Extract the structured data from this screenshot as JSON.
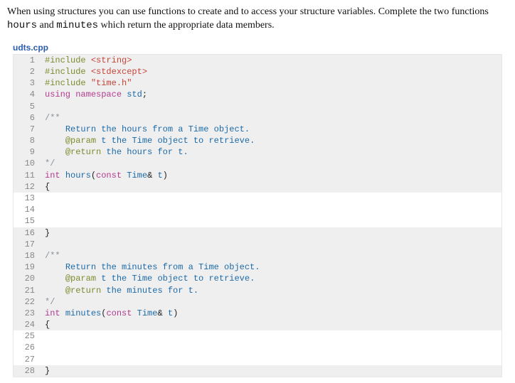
{
  "intro": {
    "part1": "When using structures you can use functions to create and to access your structure variables. Complete the two functions ",
    "func1": "hours",
    "and": " and ",
    "func2": "minutes",
    "part2": " which return the appropriate data members."
  },
  "filename": "udts.cpp",
  "lines": [
    {
      "n": "1",
      "bg": "gray",
      "segs": [
        {
          "cls": "tok-pp",
          "t": "#include "
        },
        {
          "cls": "tok-str",
          "t": "<string>"
        }
      ]
    },
    {
      "n": "2",
      "bg": "gray",
      "segs": [
        {
          "cls": "tok-pp",
          "t": "#include "
        },
        {
          "cls": "tok-str",
          "t": "<stdexcept>"
        }
      ]
    },
    {
      "n": "3",
      "bg": "gray",
      "segs": [
        {
          "cls": "tok-pp",
          "t": "#include "
        },
        {
          "cls": "tok-str",
          "t": "\"time.h\""
        }
      ]
    },
    {
      "n": "4",
      "bg": "gray",
      "segs": [
        {
          "cls": "tok-kw",
          "t": "using"
        },
        {
          "cls": "",
          "t": " "
        },
        {
          "cls": "tok-kw",
          "t": "namespace"
        },
        {
          "cls": "",
          "t": " "
        },
        {
          "cls": "tok-id",
          "t": "std"
        },
        {
          "cls": "",
          "t": ";"
        }
      ]
    },
    {
      "n": "5",
      "bg": "gray",
      "segs": [
        {
          "cls": "",
          "t": ""
        }
      ]
    },
    {
      "n": "6",
      "bg": "gray",
      "segs": [
        {
          "cls": "tok-comm",
          "t": "/**"
        }
      ]
    },
    {
      "n": "7",
      "bg": "gray",
      "segs": [
        {
          "cls": "",
          "t": "    "
        },
        {
          "cls": "tok-doc",
          "t": "Return the hours from a Time object."
        }
      ]
    },
    {
      "n": "8",
      "bg": "gray",
      "segs": [
        {
          "cls": "",
          "t": "    "
        },
        {
          "cls": "tok-pp",
          "t": "@param"
        },
        {
          "cls": "",
          "t": " "
        },
        {
          "cls": "tok-id",
          "t": "t"
        },
        {
          "cls": "tok-doc",
          "t": " the Time object to retrieve."
        }
      ]
    },
    {
      "n": "9",
      "bg": "gray",
      "segs": [
        {
          "cls": "",
          "t": "    "
        },
        {
          "cls": "tok-pp",
          "t": "@return"
        },
        {
          "cls": "tok-doc",
          "t": " the hours for t."
        }
      ]
    },
    {
      "n": "10",
      "bg": "gray",
      "segs": [
        {
          "cls": "tok-comm",
          "t": "*/"
        }
      ]
    },
    {
      "n": "11",
      "bg": "gray",
      "segs": [
        {
          "cls": "tok-kw",
          "t": "int"
        },
        {
          "cls": "",
          "t": " "
        },
        {
          "cls": "tok-id",
          "t": "hours"
        },
        {
          "cls": "",
          "t": "("
        },
        {
          "cls": "tok-kw",
          "t": "const"
        },
        {
          "cls": "",
          "t": " "
        },
        {
          "cls": "tok-id",
          "t": "Time"
        },
        {
          "cls": "",
          "t": "& "
        },
        {
          "cls": "tok-id",
          "t": "t"
        },
        {
          "cls": "",
          "t": ")"
        }
      ]
    },
    {
      "n": "12",
      "bg": "gray",
      "segs": [
        {
          "cls": "",
          "t": "{"
        }
      ]
    },
    {
      "n": "13",
      "bg": "white",
      "segs": [
        {
          "cls": "",
          "t": ""
        }
      ]
    },
    {
      "n": "14",
      "bg": "white",
      "segs": [
        {
          "cls": "",
          "t": ""
        }
      ]
    },
    {
      "n": "15",
      "bg": "white",
      "segs": [
        {
          "cls": "",
          "t": ""
        }
      ]
    },
    {
      "n": "16",
      "bg": "gray",
      "segs": [
        {
          "cls": "",
          "t": "}"
        }
      ]
    },
    {
      "n": "17",
      "bg": "gray",
      "segs": [
        {
          "cls": "",
          "t": ""
        }
      ]
    },
    {
      "n": "18",
      "bg": "gray",
      "segs": [
        {
          "cls": "tok-comm",
          "t": "/**"
        }
      ]
    },
    {
      "n": "19",
      "bg": "gray",
      "segs": [
        {
          "cls": "",
          "t": "    "
        },
        {
          "cls": "tok-doc",
          "t": "Return the minutes from a Time object."
        }
      ]
    },
    {
      "n": "20",
      "bg": "gray",
      "segs": [
        {
          "cls": "",
          "t": "    "
        },
        {
          "cls": "tok-pp",
          "t": "@param"
        },
        {
          "cls": "",
          "t": " "
        },
        {
          "cls": "tok-id",
          "t": "t"
        },
        {
          "cls": "tok-doc",
          "t": " the Time object to retrieve."
        }
      ]
    },
    {
      "n": "21",
      "bg": "gray",
      "segs": [
        {
          "cls": "",
          "t": "    "
        },
        {
          "cls": "tok-pp",
          "t": "@return"
        },
        {
          "cls": "tok-doc",
          "t": " the minutes for t."
        }
      ]
    },
    {
      "n": "22",
      "bg": "gray",
      "segs": [
        {
          "cls": "tok-comm",
          "t": "*/"
        }
      ]
    },
    {
      "n": "23",
      "bg": "gray",
      "segs": [
        {
          "cls": "tok-kw",
          "t": "int"
        },
        {
          "cls": "",
          "t": " "
        },
        {
          "cls": "tok-id",
          "t": "minutes"
        },
        {
          "cls": "",
          "t": "("
        },
        {
          "cls": "tok-kw",
          "t": "const"
        },
        {
          "cls": "",
          "t": " "
        },
        {
          "cls": "tok-id",
          "t": "Time"
        },
        {
          "cls": "",
          "t": "& "
        },
        {
          "cls": "tok-id",
          "t": "t"
        },
        {
          "cls": "",
          "t": ")"
        }
      ]
    },
    {
      "n": "24",
      "bg": "gray",
      "segs": [
        {
          "cls": "",
          "t": "{"
        }
      ]
    },
    {
      "n": "25",
      "bg": "white",
      "segs": [
        {
          "cls": "",
          "t": ""
        }
      ]
    },
    {
      "n": "26",
      "bg": "white",
      "segs": [
        {
          "cls": "",
          "t": ""
        }
      ]
    },
    {
      "n": "27",
      "bg": "white",
      "segs": [
        {
          "cls": "",
          "t": ""
        }
      ]
    },
    {
      "n": "28",
      "bg": "gray",
      "segs": [
        {
          "cls": "",
          "t": "}"
        }
      ]
    }
  ]
}
